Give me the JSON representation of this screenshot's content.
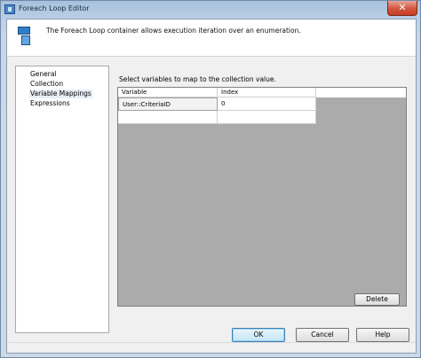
{
  "window": {
    "title": "Foreach Loop Editor",
    "close_symbol": "✕"
  },
  "header": {
    "description": "The Foreach Loop container allows execution iteration over an enumeration.",
    "icon": "foreach-container-icon"
  },
  "nav": {
    "items": [
      {
        "label": "General"
      },
      {
        "label": "Collection"
      },
      {
        "label": "Variable Mappings",
        "selected": true
      },
      {
        "label": "Expressions"
      }
    ]
  },
  "main": {
    "instruction": "Select variables to map to the collection value.",
    "grid": {
      "columns": [
        "Variable",
        "Index"
      ],
      "rows": [
        {
          "variable": "User::CriteriaID",
          "index": "0"
        },
        {
          "variable": "",
          "index": ""
        }
      ]
    },
    "delete_label": "Delete"
  },
  "footer": {
    "ok_label": "OK",
    "cancel_label": "Cancel",
    "help_label": "Help"
  },
  "colors": {
    "accent": "#3c7fb1",
    "close": "#c53c25"
  }
}
